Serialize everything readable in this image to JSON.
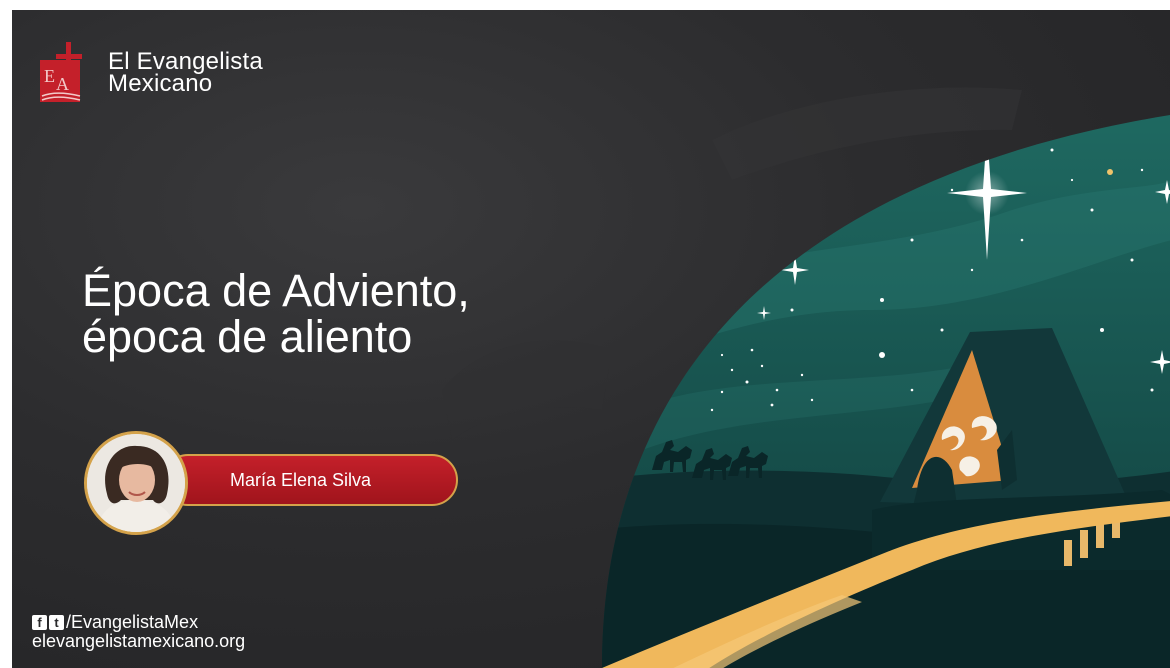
{
  "brand": {
    "name_line1": "El Evangelista",
    "name_line2": "Mexicano",
    "accent_red": "#c4202a",
    "gold": "#d4a24a",
    "teal": "#1e5a56"
  },
  "title": {
    "line1": "Época de Adviento,",
    "line2": "época de aliento"
  },
  "author": {
    "name": "María Elena Silva"
  },
  "footer": {
    "social_handle": "/EvangelistaMex",
    "website": "elevangelistamexicano.org",
    "icons": [
      "facebook-icon",
      "twitter-icon"
    ]
  }
}
